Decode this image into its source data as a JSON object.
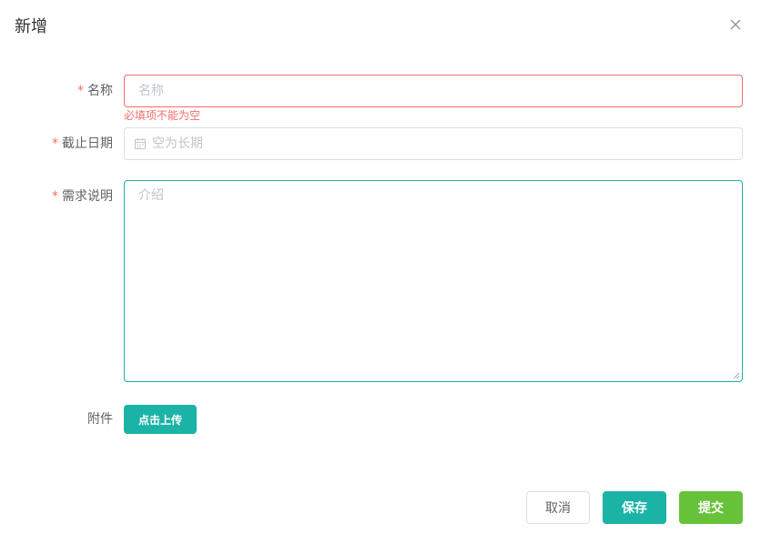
{
  "dialog": {
    "title": "新增"
  },
  "form": {
    "required_mark": "*",
    "name": {
      "label": "名称",
      "placeholder": "名称",
      "value": "",
      "error": "必填项不能为空"
    },
    "deadline": {
      "label": "截止日期",
      "placeholder": "空为长期",
      "value": ""
    },
    "description": {
      "label": "需求说明",
      "placeholder": "介绍",
      "value": ""
    },
    "attachment": {
      "label": "附件",
      "upload_label": "点击上传"
    }
  },
  "footer": {
    "cancel_label": "取消",
    "save_label": "保存",
    "submit_label": "提交"
  },
  "colors": {
    "primary": "#1bb3a6",
    "success": "#67c23a",
    "danger": "#f56c6c",
    "border": "#dcdfe6",
    "placeholder": "#c0c4cc"
  }
}
